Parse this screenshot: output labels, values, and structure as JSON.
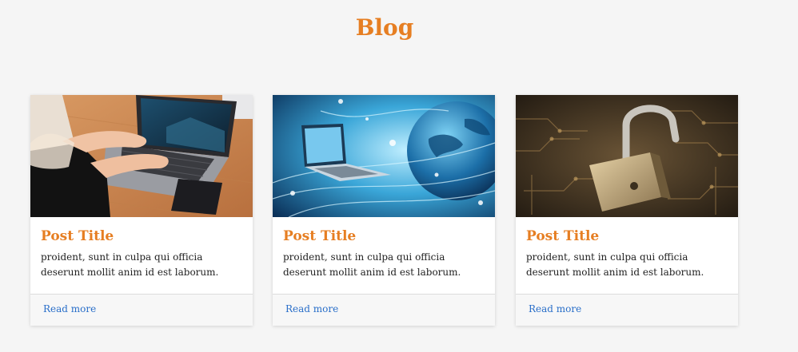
{
  "header": {
    "title": "Blog"
  },
  "colors": {
    "accent": "#e67e22",
    "link": "#2a6fc9"
  },
  "posts": [
    {
      "image_icon": "laptop-desk-photo",
      "title": "Post Title",
      "text": "proident, sunt in culpa qui officia deserunt mollit anim id est laborum.",
      "link": "Read more"
    },
    {
      "image_icon": "laptop-globe-photo",
      "title": "Post Title",
      "text": "proident, sunt in culpa qui officia deserunt mollit anim id est laborum.",
      "link": "Read more"
    },
    {
      "image_icon": "padlock-circuit-photo",
      "title": "Post Title",
      "text": "proident, sunt in culpa qui officia deserunt mollit anim id est laborum.",
      "link": "Read more"
    }
  ]
}
